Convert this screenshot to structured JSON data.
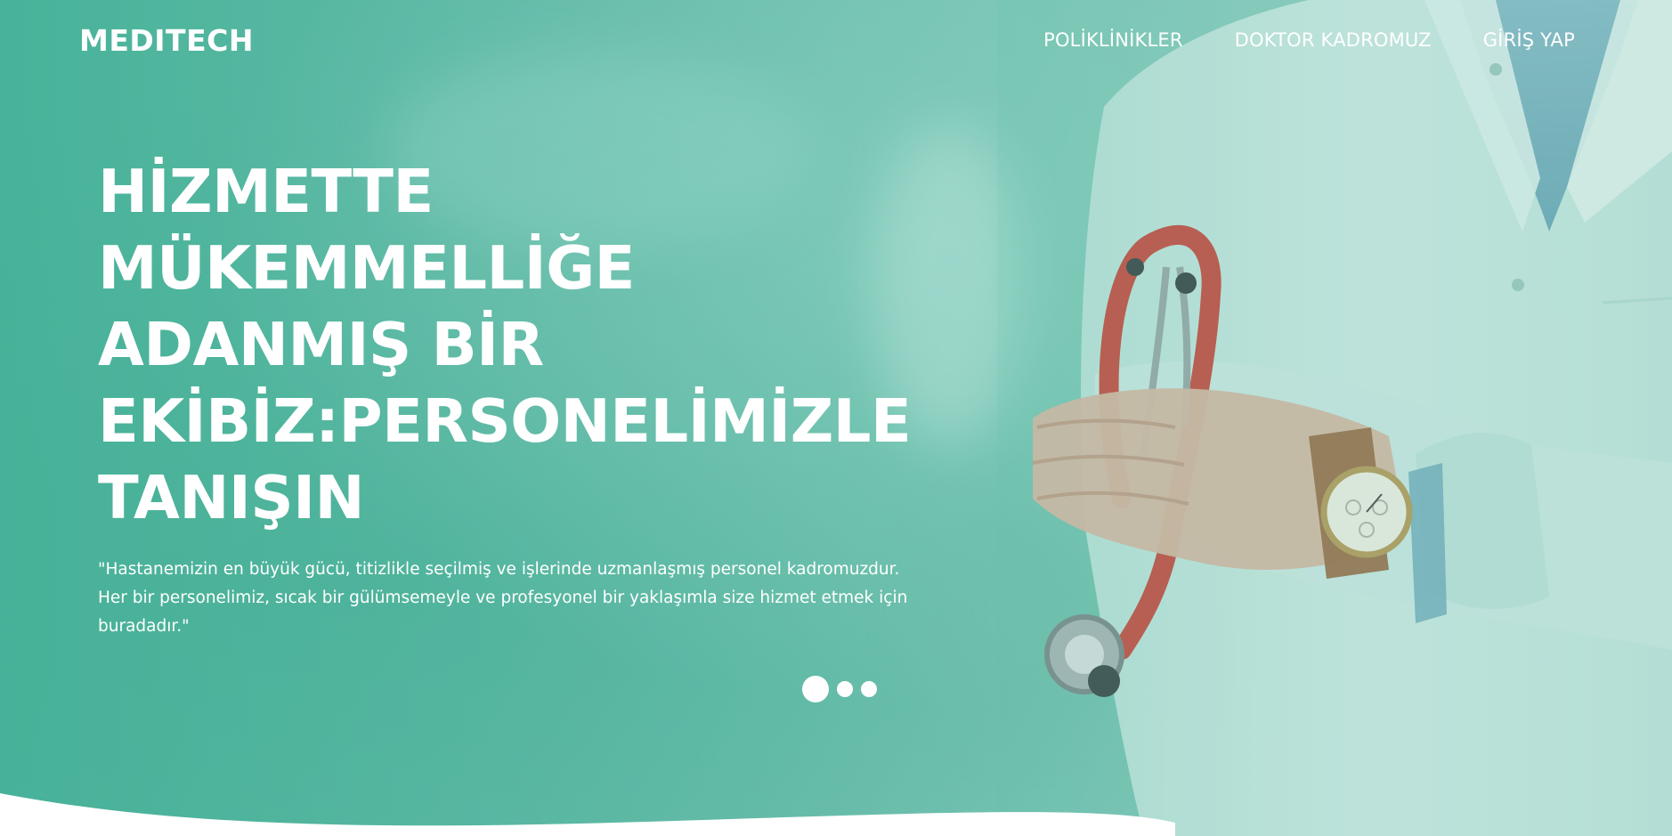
{
  "brand": {
    "name": "MEDITECH"
  },
  "nav": {
    "items": [
      {
        "label": "POLİKLİNİKLER"
      },
      {
        "label": "DOKTOR KADROMUZ"
      },
      {
        "label": "GİRİŞ YAP"
      }
    ]
  },
  "hero": {
    "headline_lines": [
      "HİZMETTE",
      "MÜKEMMELLİĞE",
      "ADANMIŞ BİR",
      "EKİBİZ:PERSONELİMİZLE",
      "TANIŞIN"
    ],
    "quote_lines": [
      "\"Hastanemizin en büyük gücü, titizlikle seçilmiş ve işlerinde uzmanlaşmış personel kadromuzdur.",
      "Her bir personelimiz, sıcak bir gülümsemeyle ve profesyonel bir yaklaşımla size hizmet etmek için",
      "buradadır.\""
    ],
    "image_subject": "doctor-with-stethoscope",
    "slider": {
      "slides": 3,
      "active": 1
    }
  },
  "colors": {
    "teal": "#48b39a",
    "teal_light": "#9bd0c6",
    "white": "#ffffff",
    "stethoscope_red": "#c94a3f",
    "coat": "#d7ece8"
  }
}
